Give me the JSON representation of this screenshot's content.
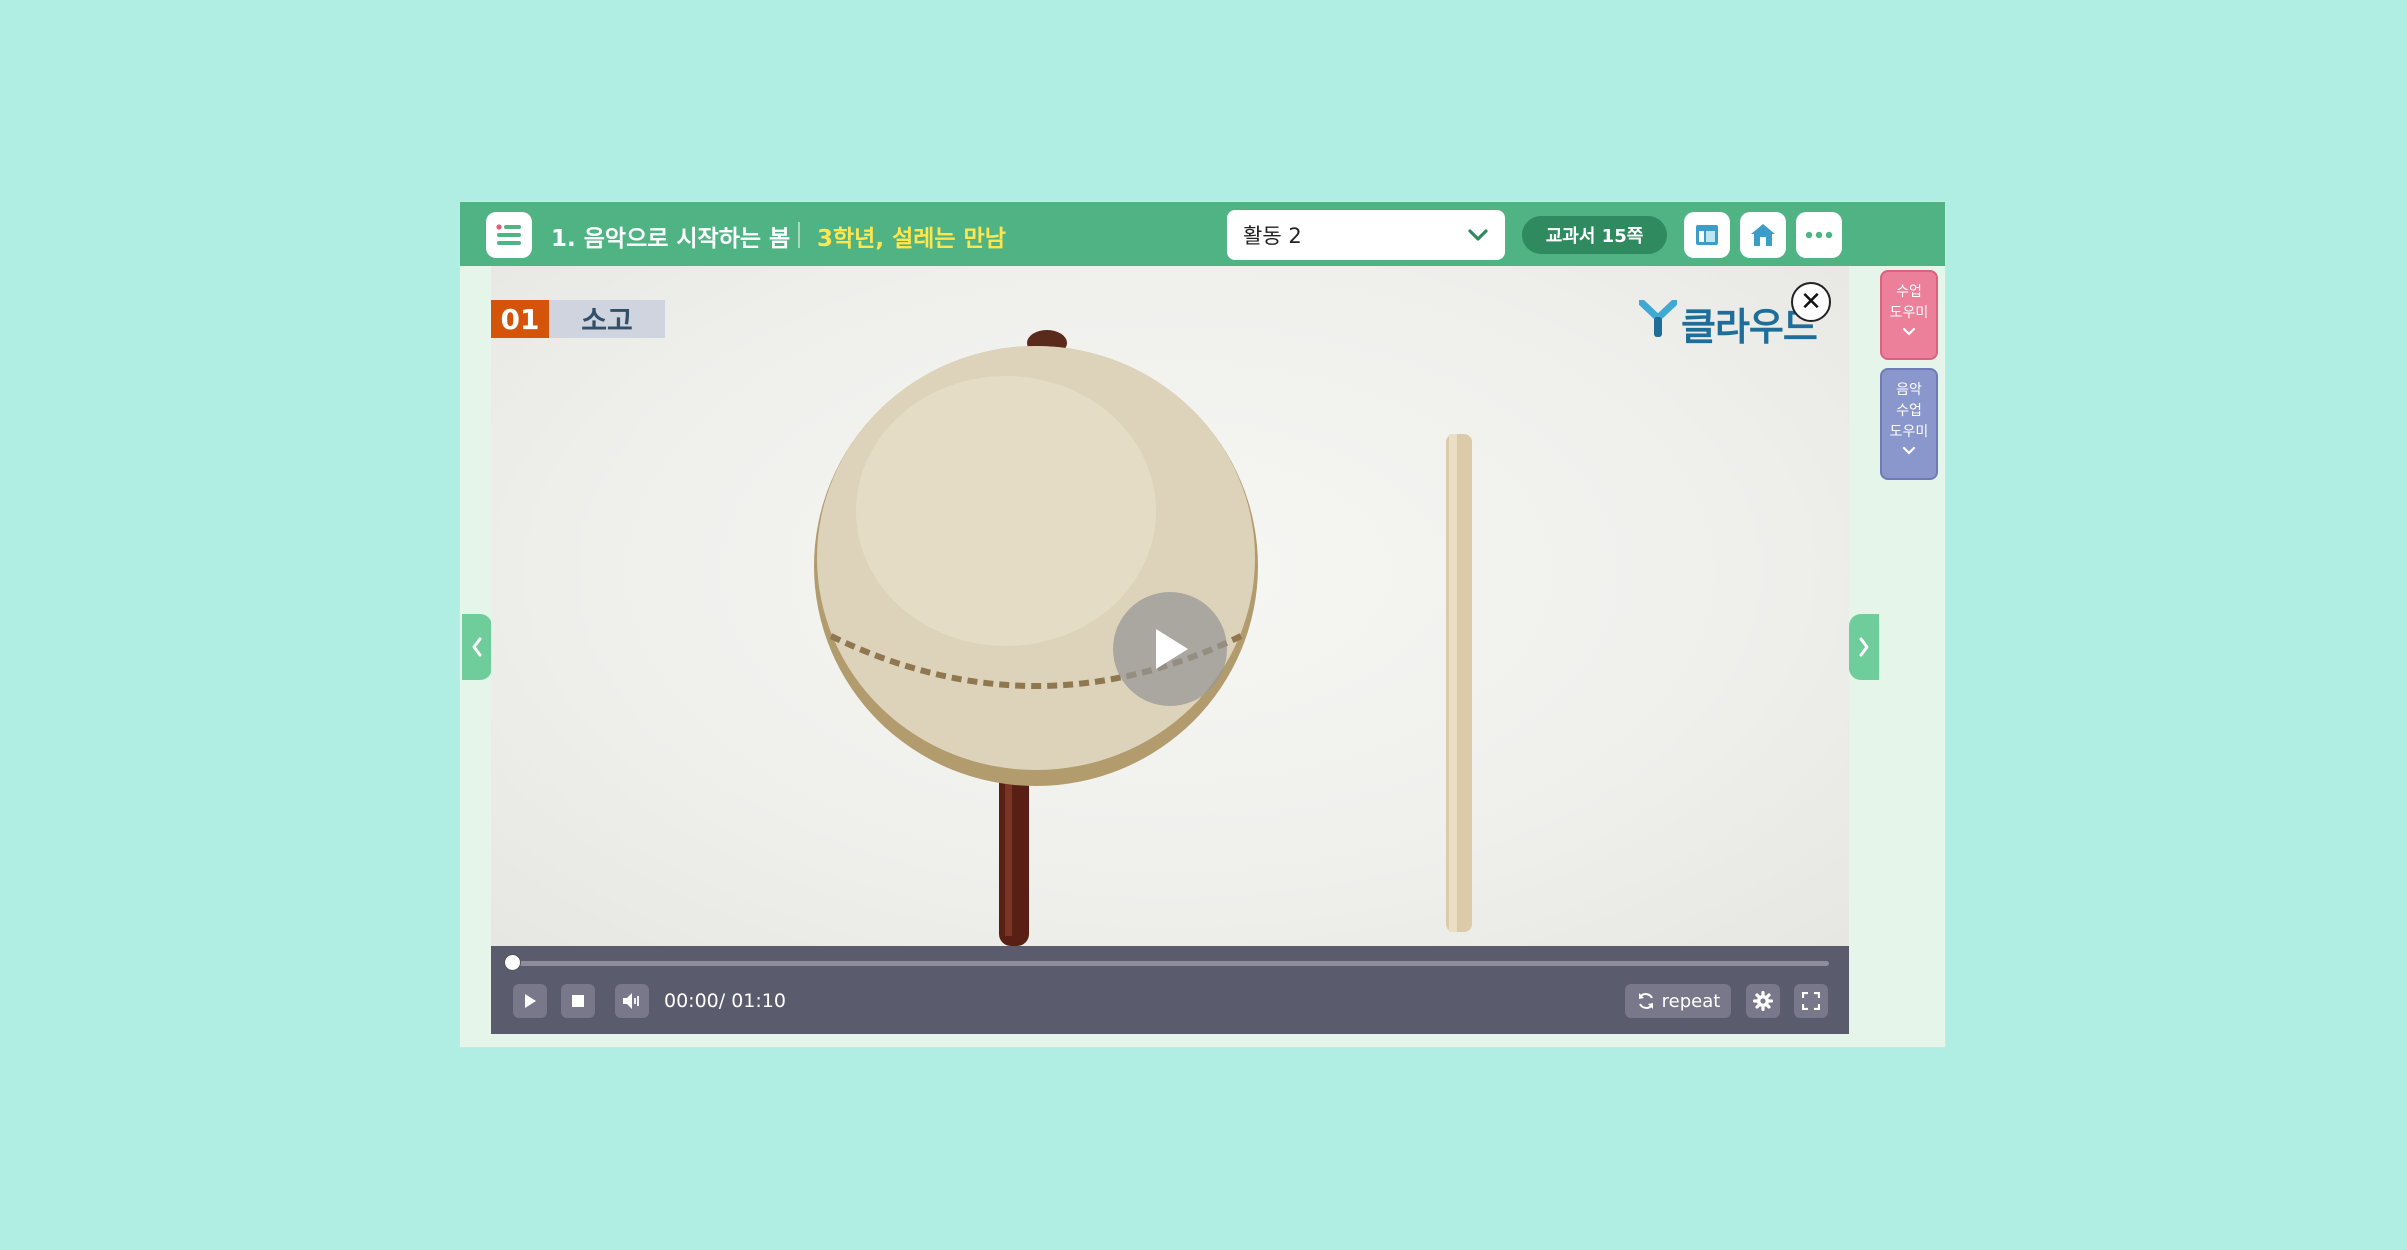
{
  "header": {
    "unit_title": "1. 음악으로 시작하는 봄",
    "lesson_title": "3학년, 설레는 만남",
    "activity_select": "활동 2",
    "textbook_page": "교과서 15쪽",
    "icons": {
      "menu": "menu-icon",
      "layout": "layout-icon",
      "home": "home-icon",
      "more": "more-icon"
    }
  },
  "video": {
    "badge_number": "01",
    "badge_title": "소고",
    "logo_text": "클라우드",
    "close_label": "✕",
    "time": "00:00/ 01:10",
    "progress": 0,
    "repeat_label": "repeat"
  },
  "side_tools": {
    "class_helper": [
      "수업",
      "도우미"
    ],
    "music_helper": [
      "음악",
      "수업",
      "도우미"
    ]
  },
  "colors": {
    "background": "#b0ede2",
    "header": "#4fb383",
    "lesson_title": "#ffe64d",
    "badge": "#d4540a",
    "class_helper": "#ec7f9a",
    "music_helper": "#8a97cd",
    "player_controls": "#5b5b6e"
  }
}
